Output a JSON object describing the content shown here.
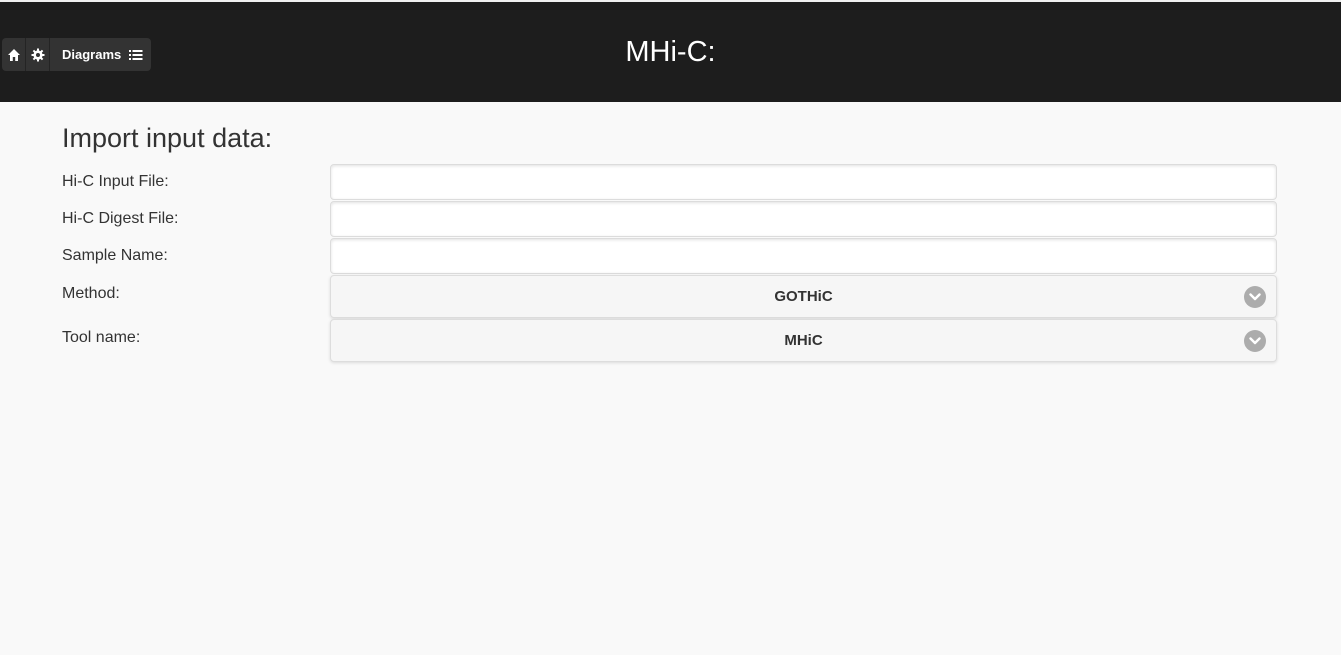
{
  "header": {
    "title": "MHi-C:",
    "nav": {
      "home_icon": "home-icon",
      "settings_icon": "gear-icon",
      "diagrams_label": "Diagrams",
      "diagrams_icon": "list-icon"
    }
  },
  "form": {
    "section_title": "Import input data:",
    "fields": [
      {
        "label": "Hi-C Input File:",
        "value": "",
        "placeholder": ""
      },
      {
        "label": "Hi-C Digest File:",
        "value": "",
        "placeholder": ""
      },
      {
        "label": "Sample Name:",
        "value": "",
        "placeholder": ""
      }
    ],
    "method": {
      "label": "Method:",
      "selected": "GOTHiC"
    },
    "tool": {
      "label": "Tool name:",
      "selected": "MHiC"
    }
  },
  "colors": {
    "header_bg": "#1d1d1d",
    "page_bg": "#f9f9f9",
    "select_bg": "#f6f6f6",
    "chevron_bg": "#acacac"
  }
}
